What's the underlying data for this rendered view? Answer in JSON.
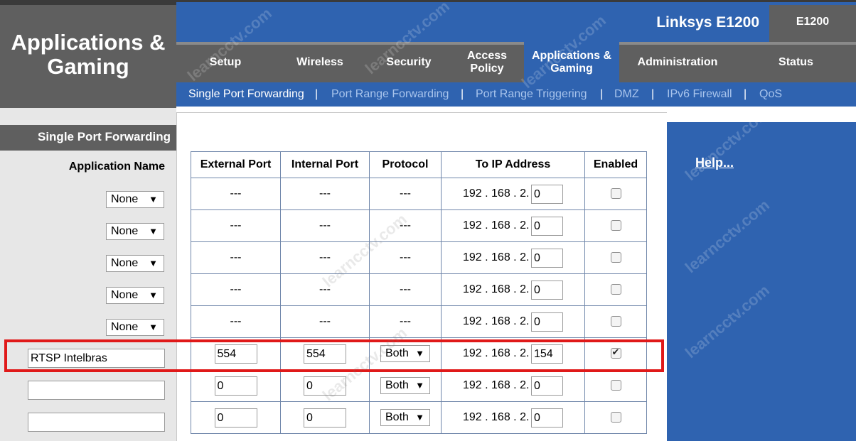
{
  "header": {
    "section_title_line1": "Applications &",
    "section_title_line2": "Gaming",
    "product_name": "Linksys E1200",
    "model": "E1200"
  },
  "tabs": [
    {
      "label_line1": "Setup",
      "label_line2": "",
      "active": false
    },
    {
      "label_line1": "Wireless",
      "label_line2": "",
      "active": false
    },
    {
      "label_line1": "Security",
      "label_line2": "",
      "active": false
    },
    {
      "label_line1": "Access",
      "label_line2": "Policy",
      "active": false
    },
    {
      "label_line1": "Applications &",
      "label_line2": "Gaming",
      "active": true
    },
    {
      "label_line1": "Administration",
      "label_line2": "",
      "active": false
    },
    {
      "label_line1": "Status",
      "label_line2": "",
      "active": false
    }
  ],
  "subnav": {
    "items": [
      "Single Port Forwarding",
      "Port Range Forwarding",
      "Port Range Triggering",
      "DMZ",
      "IPv6 Firewall",
      "QoS"
    ],
    "separator": "|",
    "active_index": 0
  },
  "left": {
    "section_heading": "Single Port Forwarding",
    "app_name_label": "Application Name"
  },
  "table": {
    "headers": [
      "External Port",
      "Internal Port",
      "Protocol",
      "To IP Address",
      "Enabled"
    ],
    "ip_prefix": "192 . 168 . 2.",
    "rows": [
      {
        "app": "None",
        "app_type": "select",
        "external": "---",
        "internal": "---",
        "protocol": "---",
        "ip_last": "0",
        "enabled": false
      },
      {
        "app": "None",
        "app_type": "select",
        "external": "---",
        "internal": "---",
        "protocol": "---",
        "ip_last": "0",
        "enabled": false
      },
      {
        "app": "None",
        "app_type": "select",
        "external": "---",
        "internal": "---",
        "protocol": "---",
        "ip_last": "0",
        "enabled": false
      },
      {
        "app": "None",
        "app_type": "select",
        "external": "---",
        "internal": "---",
        "protocol": "---",
        "ip_last": "0",
        "enabled": false
      },
      {
        "app": "None",
        "app_type": "select",
        "external": "---",
        "internal": "---",
        "protocol": "---",
        "ip_last": "0",
        "enabled": false
      },
      {
        "app": "RTSP Intelbras",
        "app_type": "text",
        "external": "554",
        "internal": "554",
        "protocol": "Both",
        "ip_last": "154",
        "enabled": true
      },
      {
        "app": "",
        "app_type": "text",
        "external": "0",
        "internal": "0",
        "protocol": "Both",
        "ip_last": "0",
        "enabled": false
      },
      {
        "app": "",
        "app_type": "text",
        "external": "0",
        "internal": "0",
        "protocol": "Both",
        "ip_last": "0",
        "enabled": false
      }
    ]
  },
  "help_link": "Help...",
  "watermark": "learncctv.com",
  "colors": {
    "brand_blue": "#2f63b0",
    "header_gray": "#5f5f5f",
    "highlight_red": "#e01919"
  }
}
